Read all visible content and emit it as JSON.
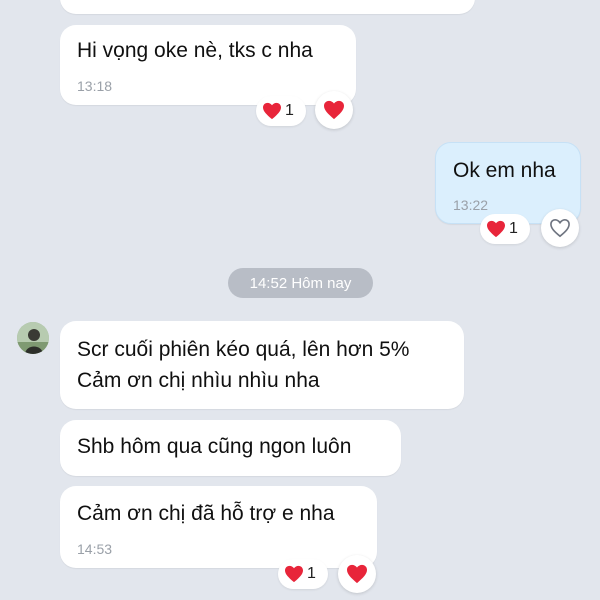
{
  "colors": {
    "background": "#e2e6ed",
    "incoming_bubble": "#ffffff",
    "outgoing_bubble": "#dbeffd",
    "heart": "#e8253a",
    "date_pill": "#b8bdc6"
  },
  "messages": [
    {
      "text": "Hi vọng oke nè, tks c nha",
      "time": "13:18",
      "reaction_count": "1",
      "react_icon": "filled-heart-icon"
    },
    {
      "text": "Ok em nha",
      "time": "13:22",
      "reaction_count": "1",
      "react_icon": "outline-heart-icon"
    },
    {
      "text": "Scr cuối phiên kéo quá, lên hơn 5%",
      "text2": "Cảm ơn chị nhìu nhìu nha"
    },
    {
      "text": "Shb hôm qua cũng ngon luôn"
    },
    {
      "text": "Cảm ơn chị đã hỗ trợ e nha",
      "time": "14:53",
      "reaction_count": "1",
      "react_icon": "filled-heart-icon"
    }
  ],
  "date_separator": "14:52 Hôm nay"
}
